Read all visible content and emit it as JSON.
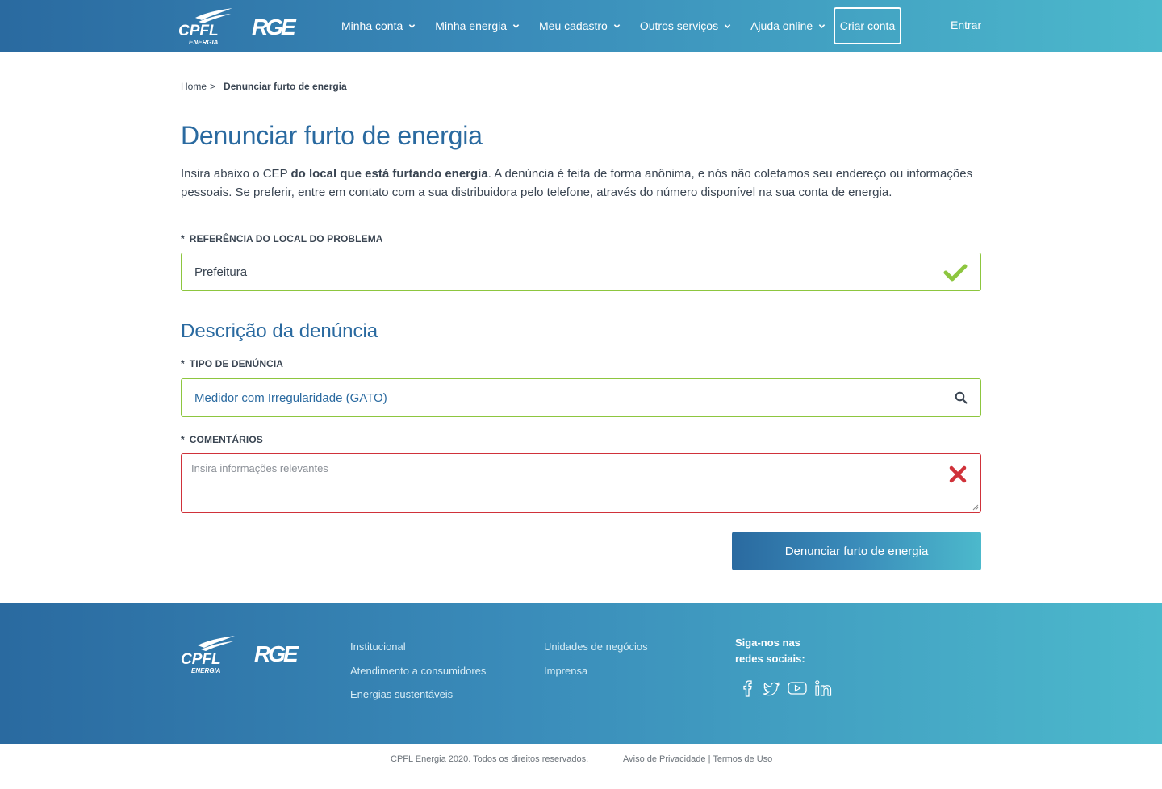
{
  "header": {
    "logo_cpfl_main": "CPFL",
    "logo_cpfl_sub": "ENERGIA",
    "logo_rge": "RGE",
    "nav": [
      {
        "label": "Minha conta"
      },
      {
        "label": "Minha energia"
      },
      {
        "label": "Meu cadastro"
      },
      {
        "label": "Outros serviços"
      },
      {
        "label": "Ajuda online"
      }
    ],
    "criar_conta": "Criar conta",
    "entrar": "Entrar"
  },
  "breadcrumb": {
    "home": "Home",
    "separator": ">",
    "current": "Denunciar furto de energia"
  },
  "main": {
    "title": "Denunciar furto de energia",
    "intro_before": "Insira abaixo o CEP ",
    "intro_bold": "do local que está furtando energia",
    "intro_after": ". A denúncia é feita de forma anônima, e nós não coletamos seu endereço ou informações pessoais. Se preferir, entre em contato com a sua distribuidora pelo telefone, através do número disponível na sua conta de energia.",
    "required_mark": "*",
    "ref_label": "REFERÊNCIA DO LOCAL DO PROBLEMA",
    "ref_value": "Prefeitura",
    "section_title": "Descrição da denúncia",
    "tipo_label": "TIPO DE DENÚNCIA",
    "tipo_value": "Medidor com Irregularidade (GATO)",
    "comentarios_label": "COMENTÁRIOS",
    "comentarios_placeholder": "Insira informações relevantes",
    "submit": "Denunciar furto de energia"
  },
  "footer": {
    "col1": [
      "Institucional",
      "Atendimento a consumidores",
      "Energias sustentáveis"
    ],
    "col2": [
      "Unidades de negócios",
      "Imprensa"
    ],
    "social_title_line1": "Siga-nos nas",
    "social_title_line2": "redes sociais:",
    "social_icons": [
      "facebook-icon",
      "twitter-icon",
      "youtube-icon",
      "linkedin-icon"
    ],
    "copyright": "CPFL Energia 2020. Todos os direitos reservados.",
    "privacy": "Aviso de Privacidade",
    "policy_sep": "|",
    "terms": "Termos de Uso"
  },
  "colors": {
    "primary": "#2a6aa0",
    "gradient_end": "#4cb9cc",
    "valid": "#8dc63f",
    "error": "#d0323a"
  }
}
